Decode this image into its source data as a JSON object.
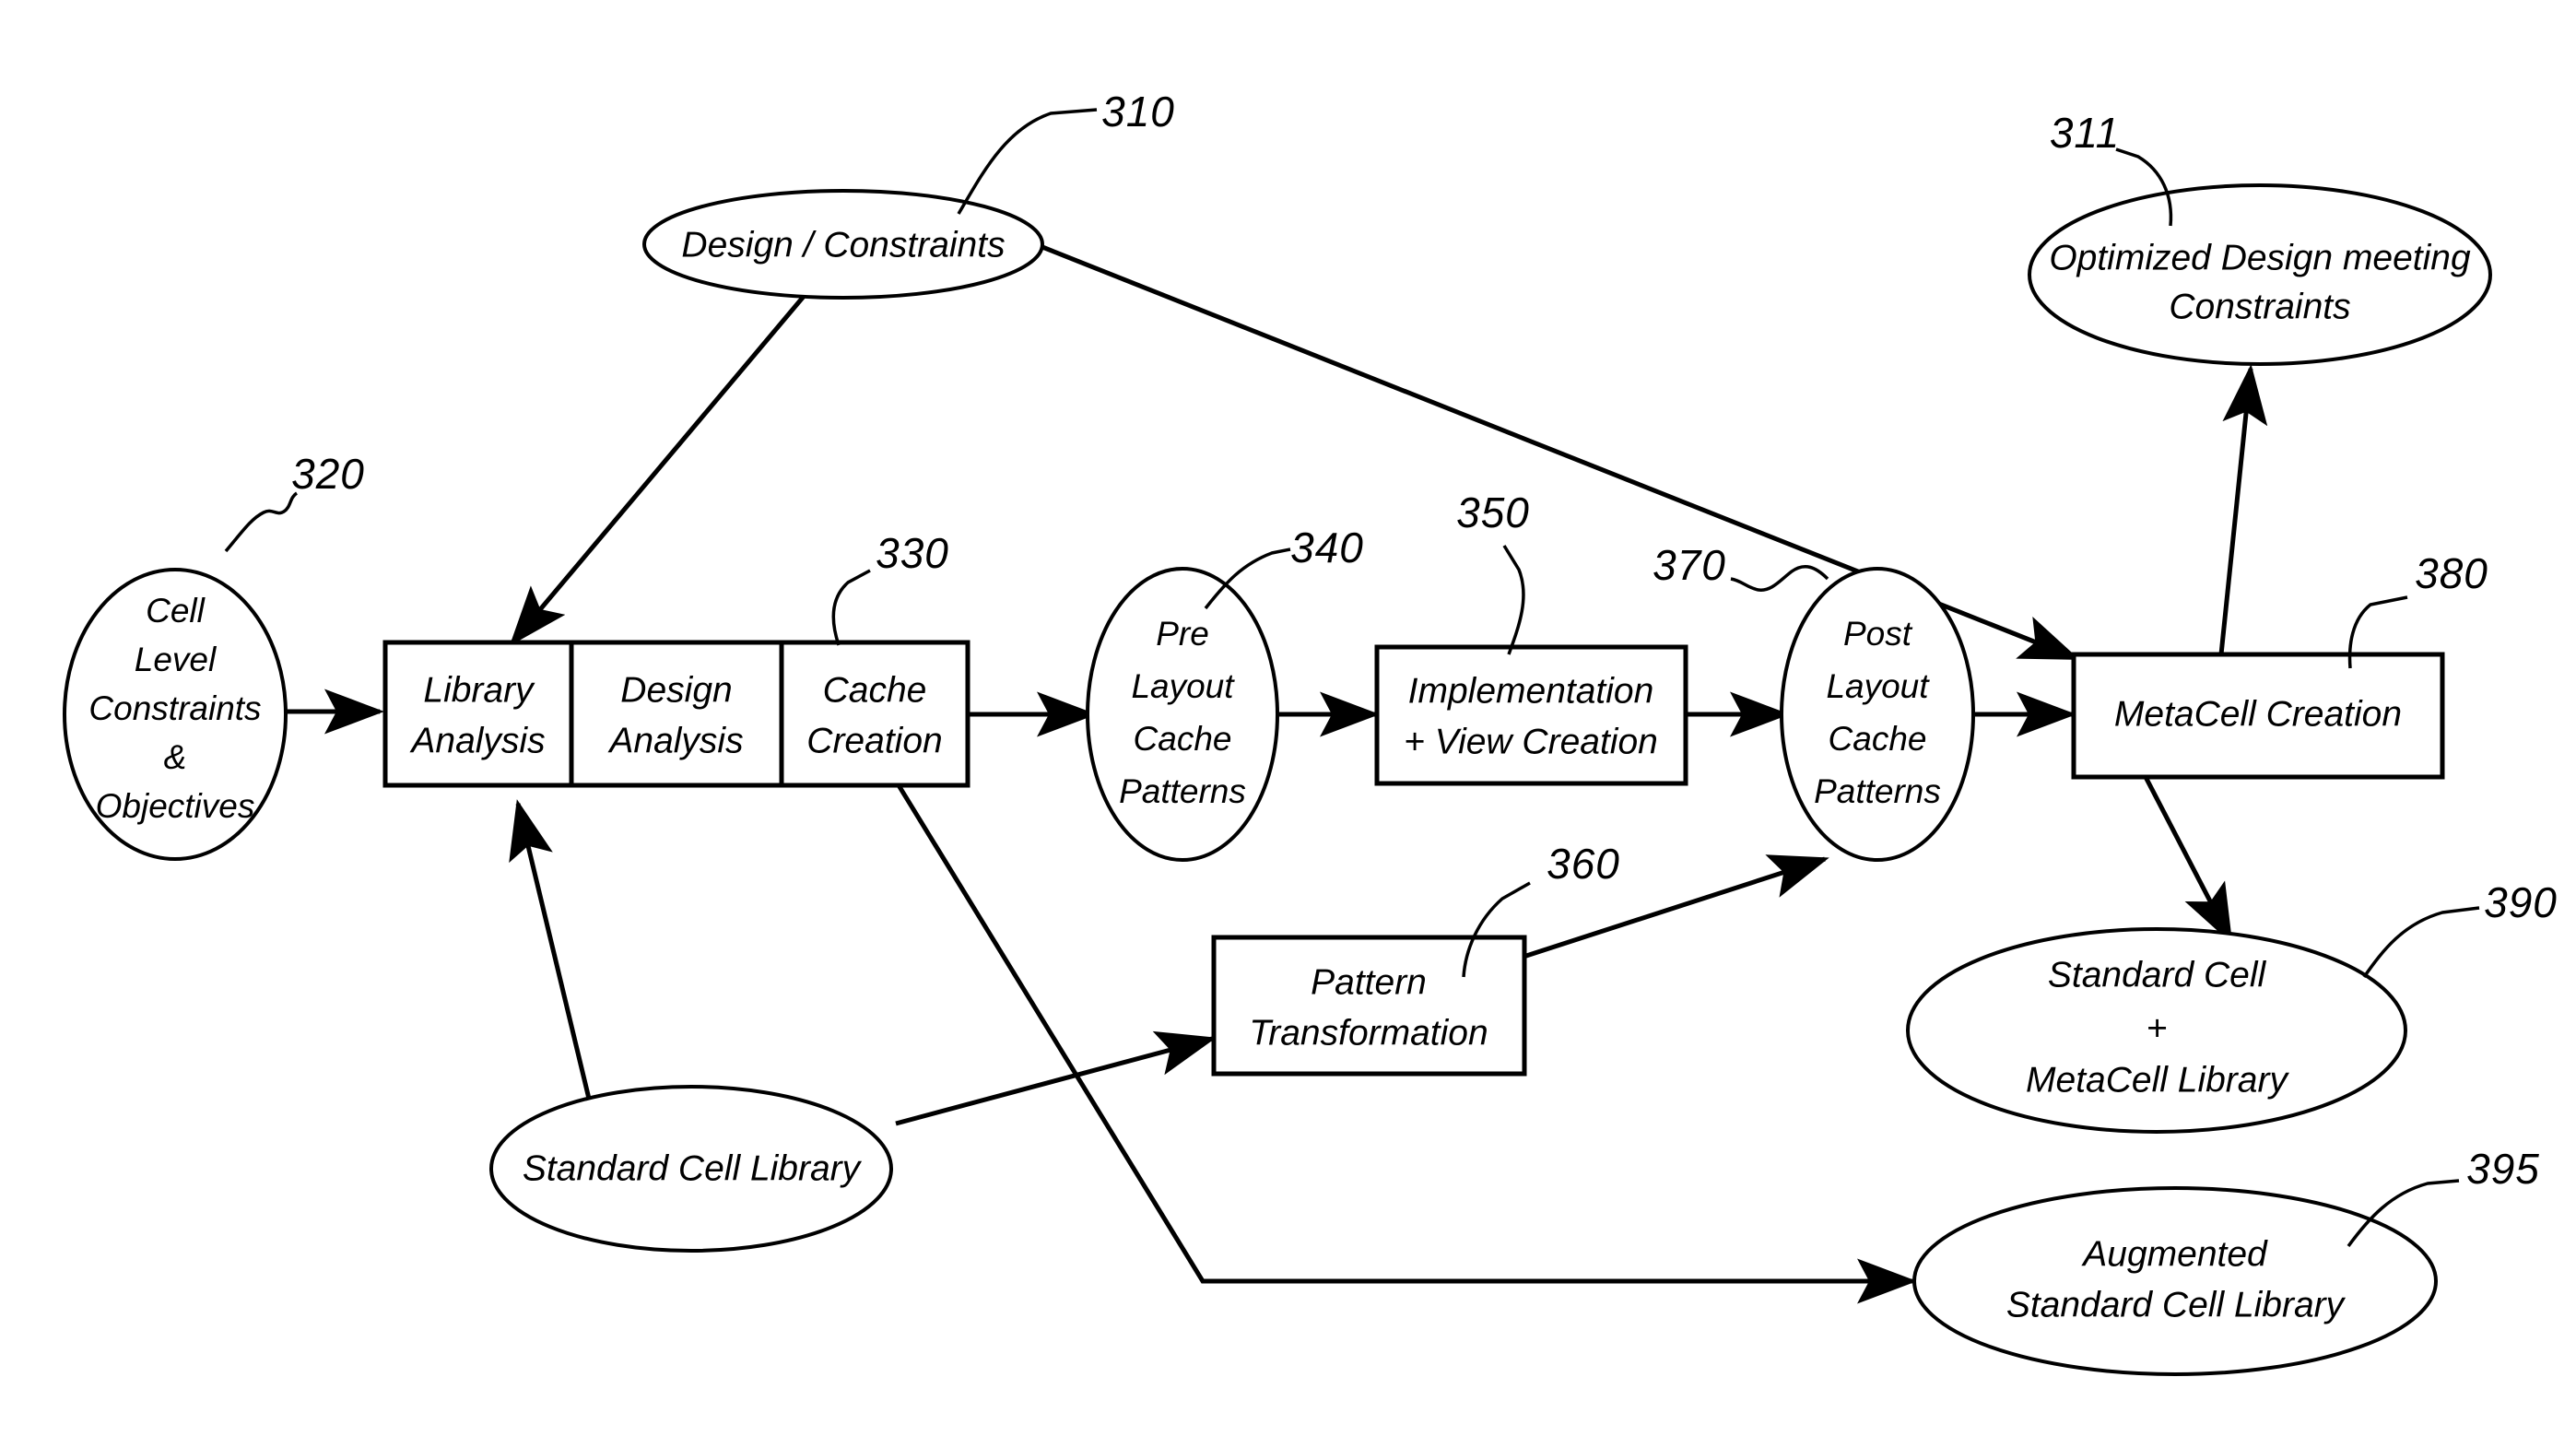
{
  "figure": {
    "type": "patent-flow-diagram",
    "background_color": "#ffffff",
    "line_color": "#000000"
  },
  "nodes": {
    "design_constraints": {
      "ref": "310",
      "shape": "ellipse",
      "lines": [
        "Design / Constraints"
      ]
    },
    "optimized_design": {
      "ref": "311",
      "shape": "ellipse",
      "lines": [
        "Optimized Design meeting",
        "Constraints"
      ]
    },
    "cell_level_constraints": {
      "ref": "320",
      "shape": "ellipse",
      "lines": [
        "Cell",
        "Level",
        "Constraints",
        "&",
        "Objectives"
      ]
    },
    "library_analysis": {
      "shape": "box",
      "lines": [
        "Library",
        "Analysis"
      ]
    },
    "design_analysis": {
      "shape": "box",
      "lines": [
        "Design",
        "Analysis"
      ]
    },
    "cache_creation": {
      "ref": "330",
      "shape": "box",
      "lines": [
        "Cache",
        "Creation"
      ]
    },
    "pre_layout_cache_patterns": {
      "ref": "340",
      "shape": "ellipse",
      "lines": [
        "Pre",
        "Layout",
        "Cache",
        "Patterns"
      ]
    },
    "implementation_view_creation": {
      "ref": "350",
      "shape": "box",
      "lines": [
        "Implementation",
        "+ View Creation"
      ]
    },
    "post_layout_cache_patterns": {
      "ref": "370",
      "shape": "ellipse",
      "lines": [
        "Post",
        "Layout",
        "Cache",
        "Patterns"
      ]
    },
    "metacell_creation": {
      "ref": "380",
      "shape": "box",
      "lines": [
        "MetaCell Creation"
      ]
    },
    "pattern_transformation": {
      "ref": "360",
      "shape": "box",
      "lines": [
        "Pattern",
        "Transformation"
      ]
    },
    "standard_cell_library": {
      "shape": "ellipse",
      "lines": [
        "Standard Cell Library"
      ]
    },
    "standard_cell_metacell_library": {
      "ref": "390",
      "shape": "ellipse",
      "lines": [
        "Standard Cell",
        "+",
        "MetaCell Library"
      ]
    },
    "augmented_standard_cell_library": {
      "ref": "395",
      "shape": "ellipse",
      "lines": [
        "Augmented",
        "Standard Cell Library"
      ]
    }
  },
  "reference_numerals": {
    "n310": "310",
    "n311": "311",
    "n320": "320",
    "n330": "330",
    "n340": "340",
    "n350": "350",
    "n360": "360",
    "n370": "370",
    "n380": "380",
    "n390": "390",
    "n395": "395"
  },
  "labels": {
    "design_constraints_l1": "Design / Constraints",
    "optimized_design_l1": "Optimized Design meeting",
    "optimized_design_l2": "Constraints",
    "cell_level_l1": "Cell",
    "cell_level_l2": "Level",
    "cell_level_l3": "Constraints",
    "cell_level_l4": "&",
    "cell_level_l5": "Objectives",
    "library_analysis_l1": "Library",
    "library_analysis_l2": "Analysis",
    "design_analysis_l1": "Design",
    "design_analysis_l2": "Analysis",
    "cache_creation_l1": "Cache",
    "cache_creation_l2": "Creation",
    "pre_layout_l1": "Pre",
    "pre_layout_l2": "Layout",
    "pre_layout_l3": "Cache",
    "pre_layout_l4": "Patterns",
    "implementation_l1": "Implementation",
    "implementation_l2": "+ View Creation",
    "post_layout_l1": "Post",
    "post_layout_l2": "Layout",
    "post_layout_l3": "Cache",
    "post_layout_l4": "Patterns",
    "metacell_creation_l1": "MetaCell Creation",
    "pattern_transformation_l1": "Pattern",
    "pattern_transformation_l2": "Transformation",
    "standard_cell_library_l1": "Standard Cell Library",
    "sc_metacell_l1": "Standard Cell",
    "sc_metacell_l2": "+",
    "sc_metacell_l3": "MetaCell Library",
    "augmented_l1": "Augmented",
    "augmented_l2": "Standard Cell Library"
  },
  "connections": [
    {
      "from": "cell_level_constraints",
      "to": "library_analysis",
      "style": "arrow"
    },
    {
      "from": "design_constraints",
      "to": "library_analysis",
      "style": "arrow"
    },
    {
      "from": "design_constraints",
      "to": "metacell_creation",
      "style": "arrow"
    },
    {
      "from": "standard_cell_library",
      "to": "library_analysis",
      "style": "arrow"
    },
    {
      "from": "standard_cell_library",
      "to": "pattern_transformation",
      "style": "arrow"
    },
    {
      "from": "cache_creation",
      "to": "pre_layout_cache_patterns",
      "style": "arrow"
    },
    {
      "from": "cache_creation",
      "to": "augmented_standard_cell_library",
      "style": "arrow"
    },
    {
      "from": "pre_layout_cache_patterns",
      "to": "implementation_view_creation",
      "style": "arrow"
    },
    {
      "from": "implementation_view_creation",
      "to": "post_layout_cache_patterns",
      "style": "arrow"
    },
    {
      "from": "pattern_transformation",
      "to": "post_layout_cache_patterns",
      "style": "arrow"
    },
    {
      "from": "post_layout_cache_patterns",
      "to": "metacell_creation",
      "style": "arrow"
    },
    {
      "from": "metacell_creation",
      "to": "optimized_design",
      "style": "arrow"
    },
    {
      "from": "metacell_creation",
      "to": "standard_cell_metacell_library",
      "style": "arrow"
    }
  ]
}
